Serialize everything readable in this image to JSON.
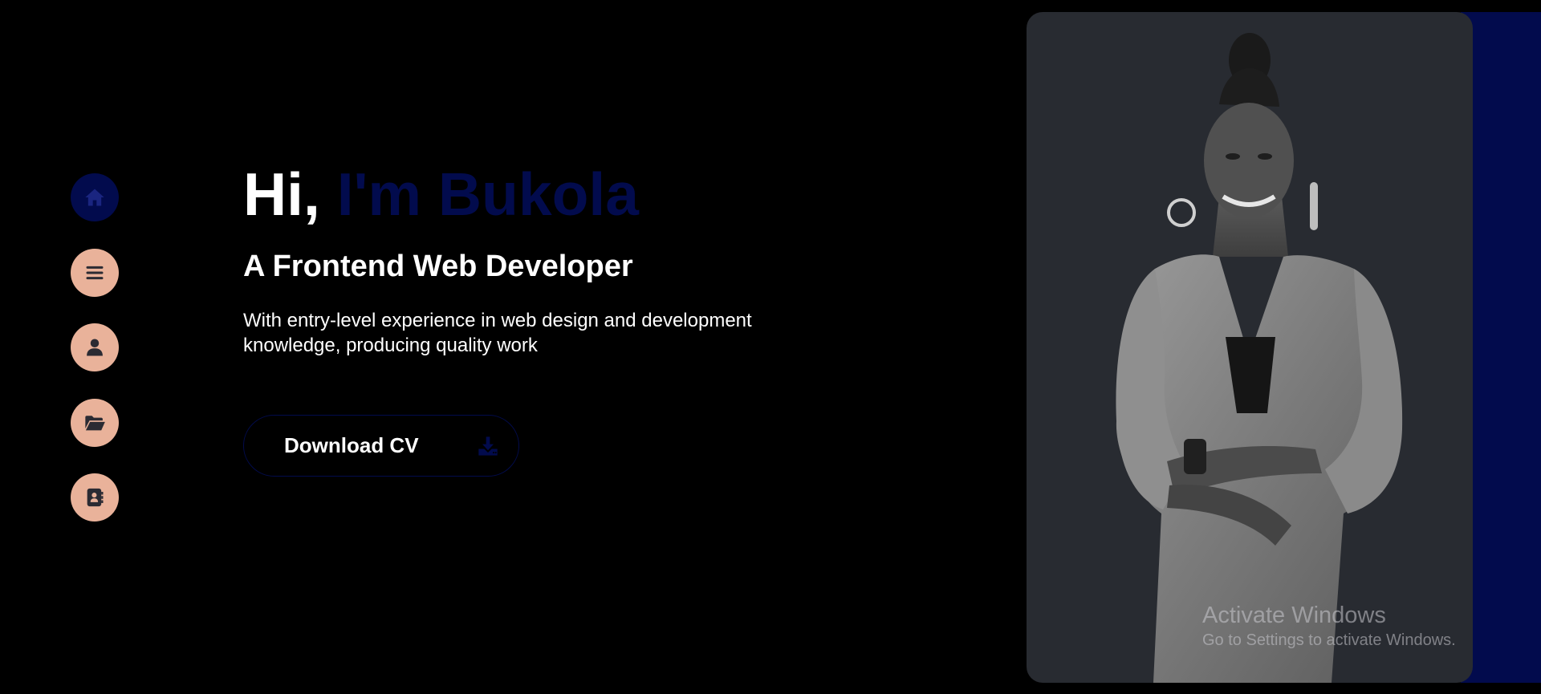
{
  "colors": {
    "background": "#000000",
    "accent": "#020b4d",
    "nav_button": "#e9b29a",
    "nav_icon": "#2b2b33",
    "card": "#282b31",
    "text": "#ffffff"
  },
  "sidebar": {
    "items": [
      {
        "icon": "home-icon",
        "active": true
      },
      {
        "icon": "menu-icon",
        "active": false
      },
      {
        "icon": "user-icon",
        "active": false
      },
      {
        "icon": "folder-open-icon",
        "active": false
      },
      {
        "icon": "address-book-icon",
        "active": false
      }
    ]
  },
  "hero": {
    "greeting_prefix": "Hi,",
    "greeting_name": "I'm Bukola",
    "subtitle": "A Frontend Web Developer",
    "description": "With entry-level experience in web design and development knowledge, producing quality work",
    "cta": {
      "label": "Download CV",
      "icon": "download-icon"
    }
  },
  "watermark": {
    "title": "Activate Windows",
    "subtitle": "Go to Settings to activate Windows."
  }
}
